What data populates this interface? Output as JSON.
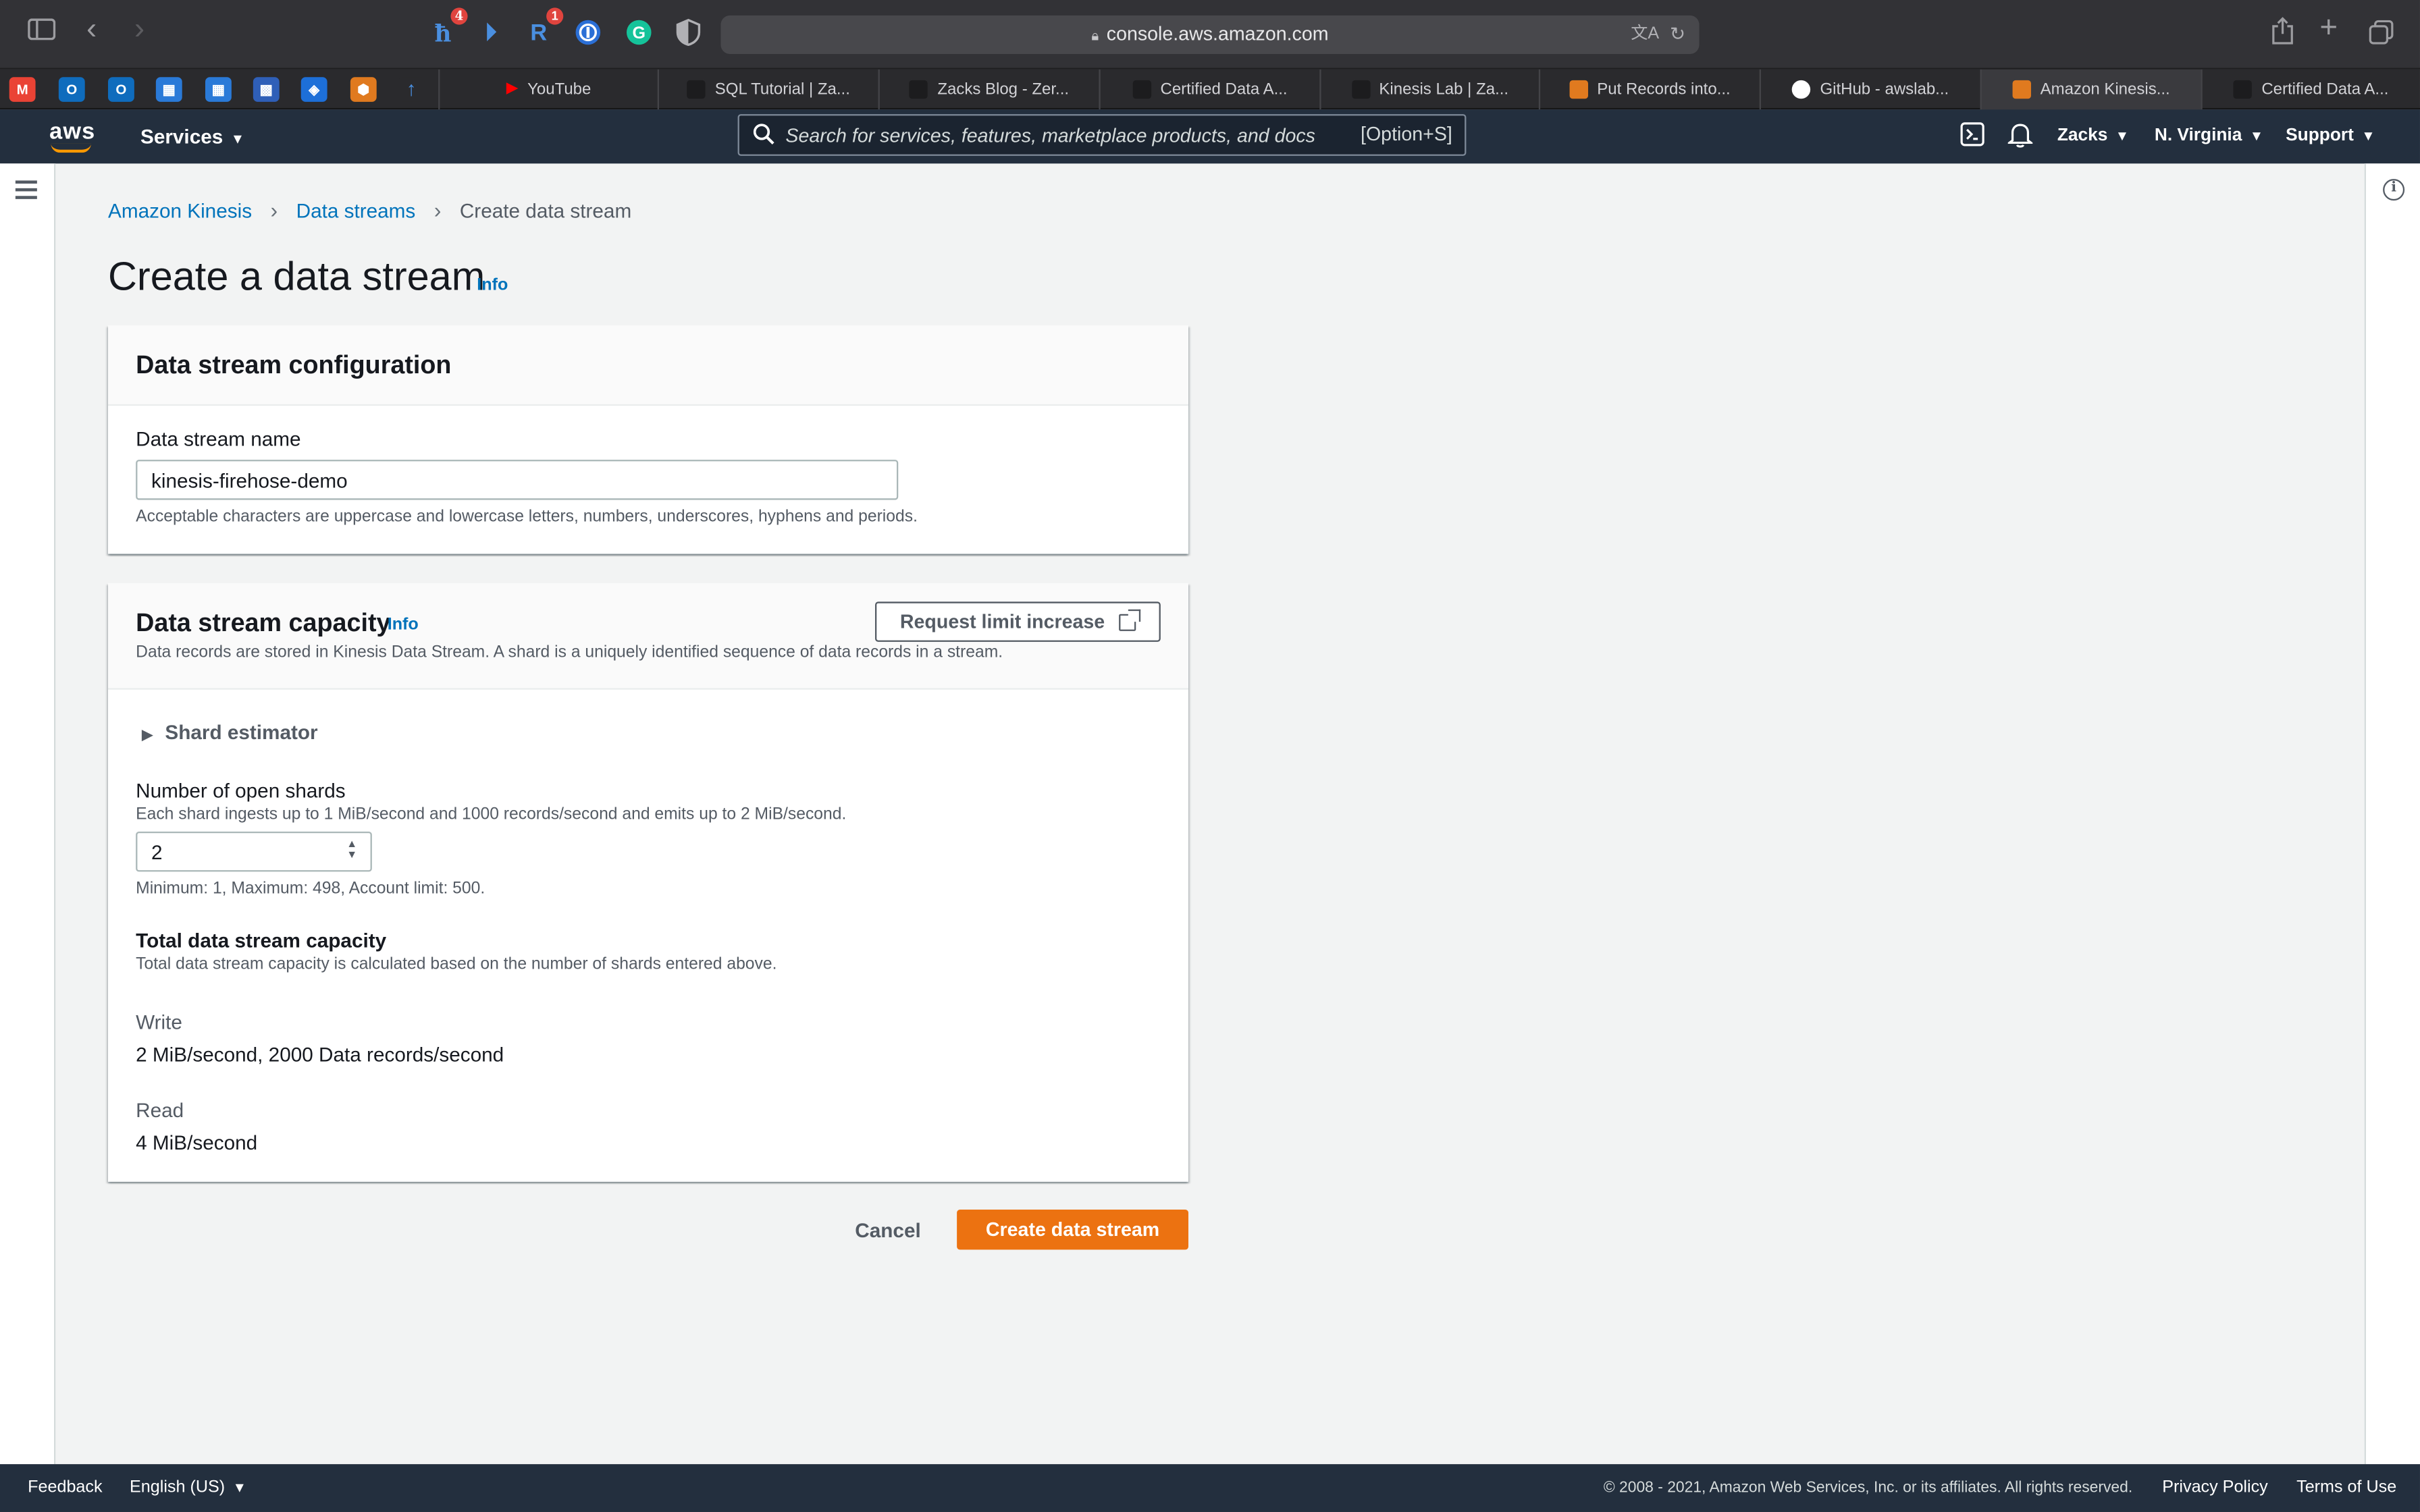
{
  "browser": {
    "address": "console.aws.amazon.com",
    "extension_badges": {
      "honey": "4",
      "readwise": "1"
    },
    "tabs": [
      {
        "label": "YouTube"
      },
      {
        "label": "SQL Tutorial | Za..."
      },
      {
        "label": "Zacks Blog - Zer..."
      },
      {
        "label": "Certified Data A..."
      },
      {
        "label": "Kinesis Lab | Za..."
      },
      {
        "label": "Put Records into..."
      },
      {
        "label": "GitHub - awslab..."
      },
      {
        "label": "Amazon Kinesis..."
      },
      {
        "label": "Certified Data A..."
      }
    ]
  },
  "aws_nav": {
    "logo": "aws",
    "services": "Services",
    "search_placeholder": "Search for services, features, marketplace products, and docs",
    "search_shortcut": "[Option+S]",
    "account": "Zacks",
    "region": "N. Virginia",
    "support": "Support"
  },
  "breadcrumb": {
    "root": "Amazon Kinesis",
    "parent": "Data streams",
    "current": "Create data stream"
  },
  "page": {
    "title": "Create a data stream",
    "info": "Info"
  },
  "config_panel": {
    "title": "Data stream configuration",
    "name_label": "Data stream name",
    "name_value": "kinesis-firehose-demo",
    "name_hint": "Acceptable characters are uppercase and lowercase letters, numbers, underscores, hyphens and periods."
  },
  "capacity_panel": {
    "title": "Data stream capacity",
    "info": "Info",
    "description": "Data records are stored in Kinesis Data Stream. A shard is a uniquely identified sequence of data records in a stream.",
    "request_limit_button": "Request limit increase",
    "shard_estimator": "Shard estimator",
    "shards_label": "Number of open shards",
    "shards_hint": "Each shard ingests up to 1 MiB/second and 1000 records/second and emits up to 2 MiB/second.",
    "shards_value": "2",
    "shards_limits": "Minimum: 1, Maximum: 498, Account limit: 500.",
    "total_label": "Total data stream capacity",
    "total_hint": "Total data stream capacity is calculated based on the number of shards entered above.",
    "write_label": "Write",
    "write_value": "2 MiB/second, 2000 Data records/second",
    "read_label": "Read",
    "read_value": "4 MiB/second"
  },
  "actions": {
    "cancel": "Cancel",
    "create": "Create data stream"
  },
  "footer": {
    "feedback": "Feedback",
    "language": "English (US)",
    "copyright": "© 2008 - 2021, Amazon Web Services, Inc. or its affiliates. All rights reserved.",
    "privacy": "Privacy Policy",
    "terms": "Terms of Use"
  },
  "colors": {
    "aws_nav_bg": "#232f3e",
    "link": "#0073bb",
    "primary_button": "#ec7211",
    "page_bg": "#f2f3f3"
  }
}
